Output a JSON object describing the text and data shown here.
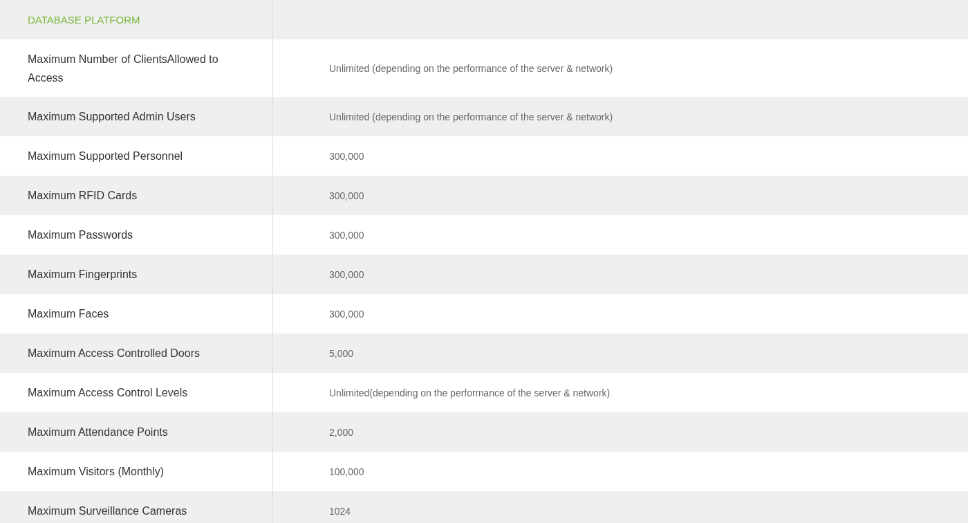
{
  "section_title": "DATABASE PLATFORM",
  "rows": [
    {
      "label": "Maximum Number of ClientsAllowed to Access",
      "value": "Unlimited (depending on the performance of the server & network)"
    },
    {
      "label": "Maximum Supported Admin Users",
      "value": "Unlimited (depending on the performance of the server & network)"
    },
    {
      "label": "Maximum Supported Personnel",
      "value": "300,000"
    },
    {
      "label": "Maximum RFID Cards",
      "value": "300,000"
    },
    {
      "label": "Maximum Passwords",
      "value": "300,000"
    },
    {
      "label": "Maximum Fingerprints",
      "value": "300,000"
    },
    {
      "label": "Maximum Faces",
      "value": "300,000"
    },
    {
      "label": "Maximum Access Controlled Doors",
      "value": "5,000"
    },
    {
      "label": "Maximum Access Control Levels",
      "value": "Unlimited(depending on the performance of the server & network)"
    },
    {
      "label": "Maximum Attendance Points",
      "value": "2,000"
    },
    {
      "label": "Maximum Visitors (Monthly)",
      "value": "100,000"
    },
    {
      "label": "Maximum Surveillance Cameras",
      "value": "1024"
    }
  ]
}
